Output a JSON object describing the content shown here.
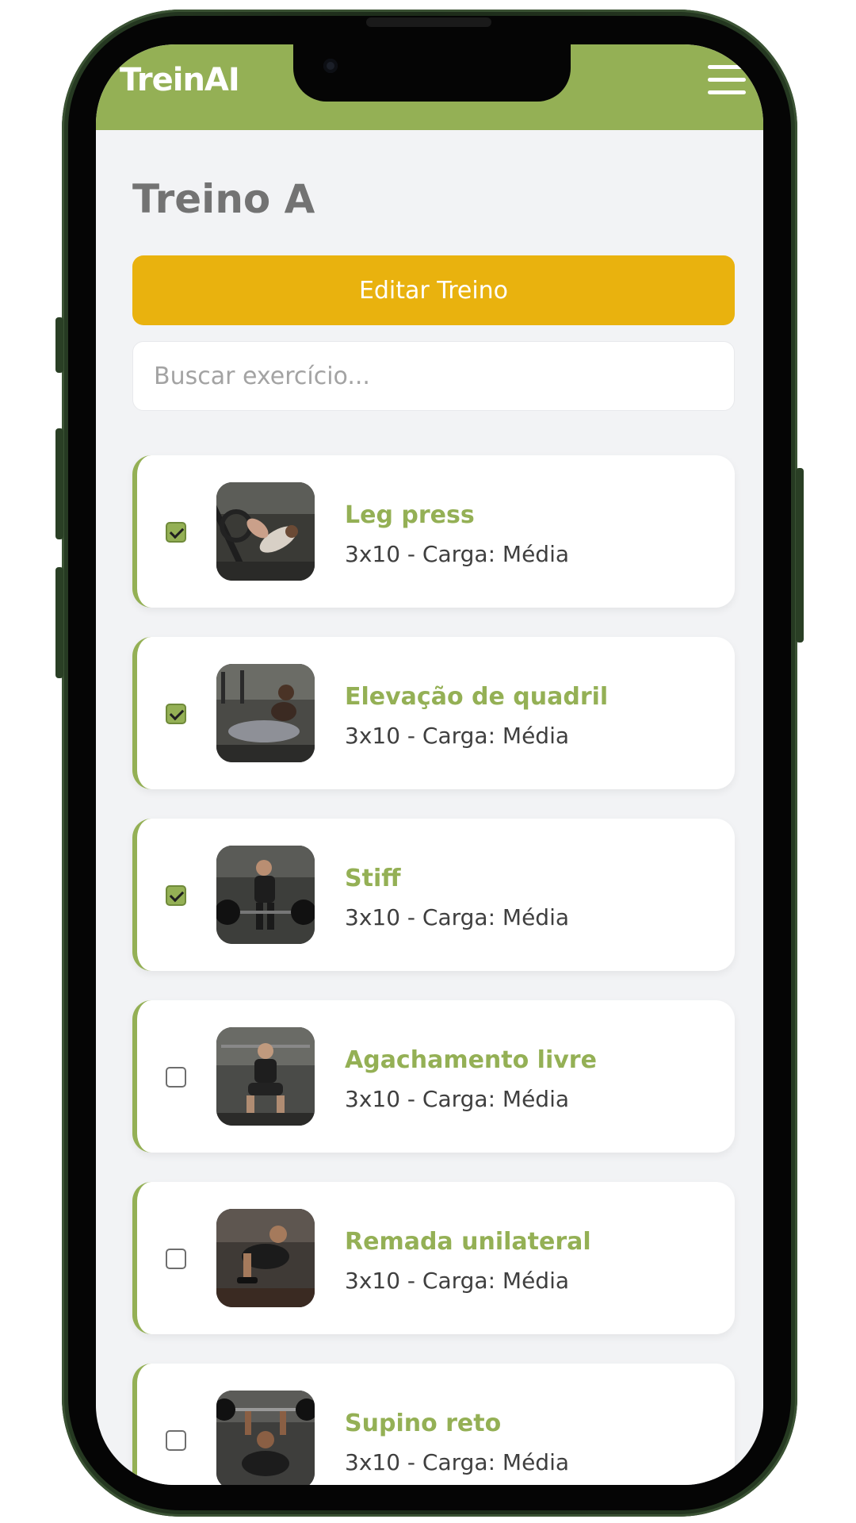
{
  "app": {
    "brand": "TreinAI",
    "menu_icon": "hamburger-menu-icon",
    "accent_color": "#94b055",
    "button_color": "#e9b20e"
  },
  "page": {
    "title": "Treino A",
    "edit_button_label": "Editar Treino",
    "search_placeholder": "Buscar exercício..."
  },
  "exercises": [
    {
      "name": "Leg press",
      "detail": "3x10 - Carga: Média",
      "checked": true
    },
    {
      "name": "Elevação de quadril",
      "detail": "3x10 - Carga: Média",
      "checked": true
    },
    {
      "name": "Stiff",
      "detail": "3x10 - Carga: Média",
      "checked": true
    },
    {
      "name": "Agachamento livre",
      "detail": "3x10 - Carga: Média",
      "checked": false
    },
    {
      "name": "Remada unilateral",
      "detail": "3x10 - Carga: Média",
      "checked": false
    },
    {
      "name": "Supino reto",
      "detail": "3x10 - Carga: Média",
      "checked": false
    }
  ]
}
